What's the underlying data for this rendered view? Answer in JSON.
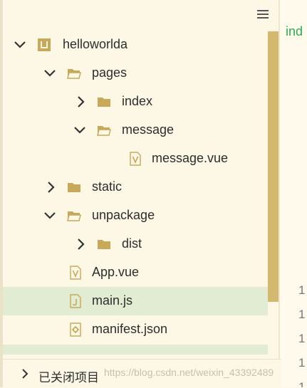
{
  "tree": {
    "items": [
      {
        "label": "helloworlda",
        "icon": "project-icon",
        "expanded": true
      },
      {
        "label": "pages",
        "icon": "folder-open-icon",
        "expanded": true
      },
      {
        "label": "index",
        "icon": "folder-icon",
        "expanded": false
      },
      {
        "label": "message",
        "icon": "folder-open-icon",
        "expanded": true
      },
      {
        "label": "message.vue",
        "icon": "vue-file-icon"
      },
      {
        "label": "static",
        "icon": "folder-icon",
        "expanded": false
      },
      {
        "label": "unpackage",
        "icon": "folder-open-icon",
        "expanded": true
      },
      {
        "label": "dist",
        "icon": "folder-icon",
        "expanded": false
      },
      {
        "label": "App.vue",
        "icon": "vue-file-icon"
      },
      {
        "label": "main.js",
        "icon": "js-file-icon",
        "selected": true
      },
      {
        "label": "manifest.json",
        "icon": "json-file-icon"
      }
    ]
  },
  "editor": {
    "text": "ind",
    "line_numbers": [
      "1",
      "1",
      "1",
      "1",
      "1"
    ]
  },
  "bottom": {
    "closed_projects_label": "已关闭项目"
  },
  "watermark": "https://blog.csdn.net/weixin_43392489",
  "colors": {
    "background": "#fdf8e6",
    "folder": "#c8a95a",
    "selected_row": "#e2ecd2",
    "scrollbar": "#d3b86f",
    "editor_text": "#2bab55"
  }
}
